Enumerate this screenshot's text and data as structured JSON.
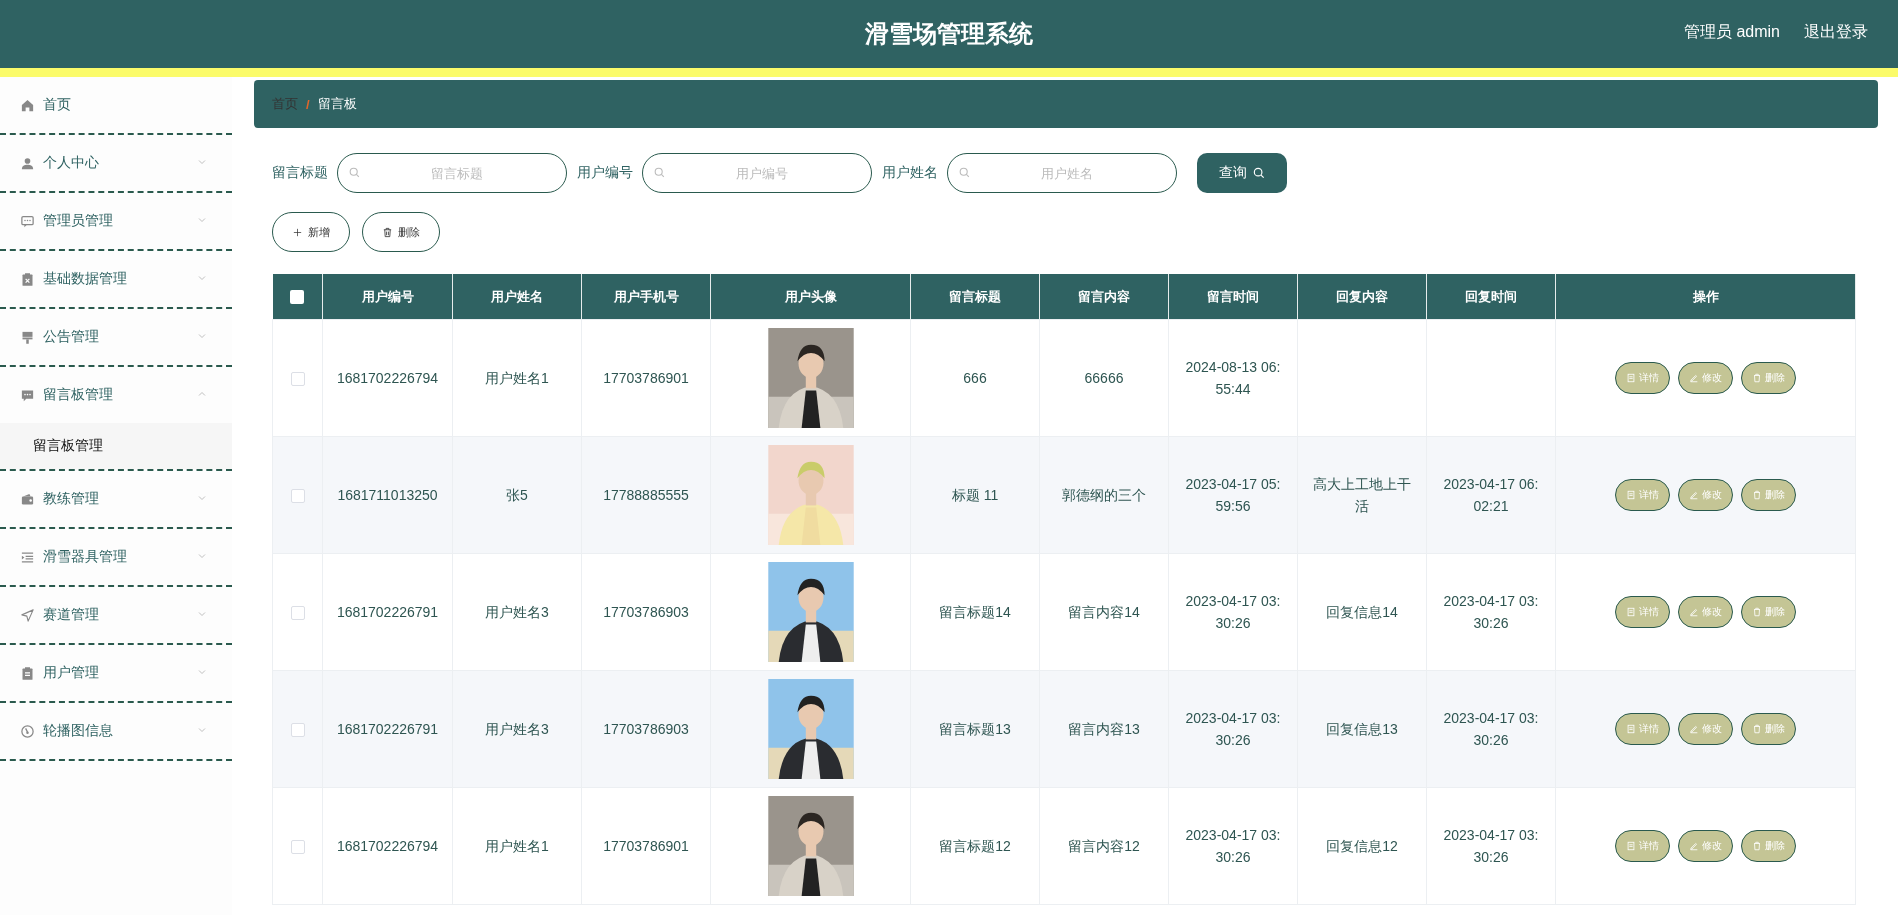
{
  "header": {
    "title": "滑雪场管理系统",
    "user": "管理员 admin",
    "logout": "退出登录"
  },
  "sidebar": {
    "items": [
      {
        "label": "首页"
      },
      {
        "label": "个人中心",
        "expanded": false
      },
      {
        "label": "管理员管理",
        "expanded": false
      },
      {
        "label": "基础数据管理",
        "expanded": false
      },
      {
        "label": "公告管理",
        "expanded": false
      },
      {
        "label": "留言板管理",
        "expanded": true,
        "children": [
          {
            "label": "留言板管理",
            "selected": true
          }
        ]
      },
      {
        "label": "教练管理",
        "expanded": false
      },
      {
        "label": "滑雪器具管理",
        "expanded": false
      },
      {
        "label": "赛道管理",
        "expanded": false
      },
      {
        "label": "用户管理",
        "expanded": false
      },
      {
        "label": "轮播图信息",
        "expanded": false
      }
    ]
  },
  "breadcrumb": {
    "items": [
      "首页",
      "留言板"
    ],
    "separator": "/"
  },
  "search": {
    "fields": [
      {
        "label": "留言标题",
        "placeholder": "留言标题"
      },
      {
        "label": "用户编号",
        "placeholder": "用户编号"
      },
      {
        "label": "用户姓名",
        "placeholder": "用户姓名"
      }
    ],
    "button": "查询"
  },
  "toolbar": {
    "buttons": [
      {
        "kind": "add",
        "label": "新增"
      },
      {
        "kind": "delete",
        "label": "删除"
      }
    ]
  },
  "table": {
    "select_all": {
      "checked": false
    },
    "columns": [
      "用户编号",
      "用户姓名",
      "用户手机号",
      "用户头像",
      "留言标题",
      "留言内容",
      "留言时间",
      "回复内容",
      "回复时间",
      "操作"
    ],
    "rows": [
      {
        "checked": false,
        "id": "1681702226794",
        "name": "用户姓名1",
        "phone": "17703786901",
        "title": "666",
        "content": "66666",
        "time": "2024-08-13 06:55:44",
        "actions": [
          "详情",
          "修改",
          "删除"
        ]
      },
      {
        "checked": false,
        "id": "1681711013250",
        "name": "张5",
        "phone": "17788885555",
        "title": "标题 11",
        "content": "郭德纲的三个",
        "time": "2023-04-17 05:59:56",
        "reply": "高大上工地上干活",
        "reply_time": "2023-04-17 06:02:21",
        "actions": [
          "详情",
          "修改",
          "删除"
        ]
      },
      {
        "checked": false,
        "id": "1681702226791",
        "name": "用户姓名3",
        "phone": "17703786903",
        "title": "留言标题14",
        "content": "留言内容14",
        "time": "2023-04-17 03:30:26",
        "reply": "回复信息14",
        "reply_time": "2023-04-17 03:30:26",
        "actions": [
          "详情",
          "修改",
          "删除"
        ]
      },
      {
        "checked": false,
        "id": "1681702226791",
        "name": "用户姓名3",
        "phone": "17703786903",
        "title": "留言标题13",
        "content": "留言内容13",
        "time": "2023-04-17 03:30:26",
        "reply": "回复信息13",
        "reply_time": "2023-04-17 03:30:26",
        "actions": [
          "详情",
          "修改",
          "删除"
        ]
      },
      {
        "checked": false,
        "id": "1681702226794",
        "name": "用户姓名1",
        "phone": "17703786901",
        "title": "留言标题12",
        "content": "留言内容12",
        "time": "2023-04-17 03:30:26",
        "reply": "回复信息12",
        "reply_time": "2023-04-17 03:30:26",
        "actions": [
          "详情",
          "修改",
          "删除"
        ]
      }
    ]
  }
}
